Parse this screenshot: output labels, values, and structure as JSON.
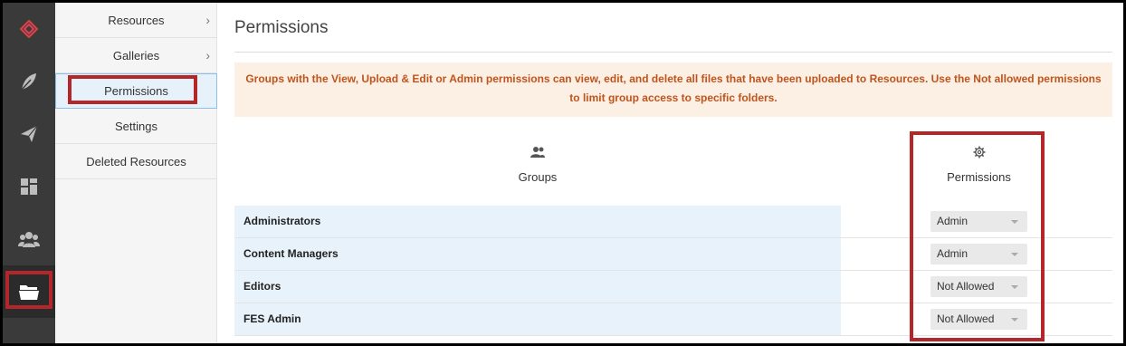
{
  "rail": {
    "items": [
      {
        "icon": "brand-logo-icon"
      },
      {
        "icon": "feather-icon"
      },
      {
        "icon": "paper-plane-icon"
      },
      {
        "icon": "dashboard-icon"
      },
      {
        "icon": "users-icon"
      },
      {
        "icon": "folder-icon",
        "active": true
      }
    ],
    "accent": "#b3262a"
  },
  "subnav": {
    "items": [
      {
        "label": "Resources",
        "chevron": "›"
      },
      {
        "label": "Galleries",
        "chevron": "›"
      },
      {
        "label": "Permissions",
        "active": true
      },
      {
        "label": "Settings"
      },
      {
        "label": "Deleted Resources"
      }
    ]
  },
  "main": {
    "title": "Permissions",
    "notice": "Groups with the View, Upload & Edit or Admin permissions can view, edit, and delete all files that have been uploaded to Resources. Use the Not allowed permissions to limit group access to specific folders.",
    "columns": {
      "groups": {
        "label": "Groups",
        "icon": "group-icon"
      },
      "permissions": {
        "label": "Permissions",
        "icon": "gear-icon"
      }
    },
    "rows": [
      {
        "group": "Administrators",
        "permission": "Admin"
      },
      {
        "group": "Content Managers",
        "permission": "Admin"
      },
      {
        "group": "Editors",
        "permission": "Not Allowed"
      },
      {
        "group": "FES Admin",
        "permission": "Not Allowed"
      }
    ]
  },
  "colors": {
    "notice_bg": "#fcefe3",
    "notice_text": "#c0541d",
    "highlight": "#b3262a",
    "row_bg": "#e7f2fb"
  }
}
